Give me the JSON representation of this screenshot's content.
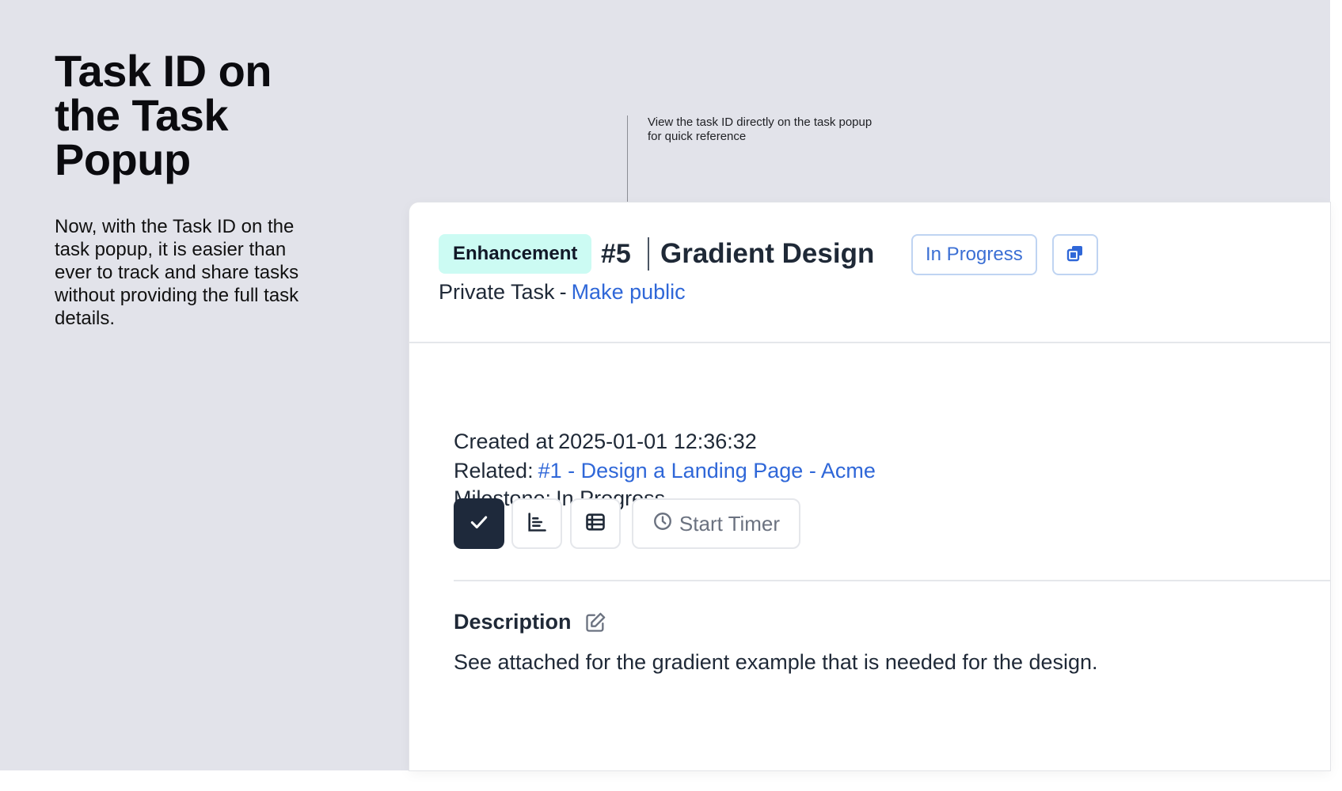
{
  "hero": {
    "title": "Task ID on the Task Popup",
    "description": "Now, with the Task ID on the task popup, it is easier than ever to track and share tasks without providing the full task details."
  },
  "callout": {
    "text": "View the task ID directly on the task popup for quick reference"
  },
  "task": {
    "tag": "Enhancement",
    "id": "#5",
    "title": "Gradient Design",
    "status": "In Progress",
    "copy_icon": "copy-icon",
    "privacy_label": "Private Task",
    "privacy_separator": "-",
    "make_public_link": "Make public",
    "created_label": "Created at",
    "created_value": "2025-01-01 12:36:32",
    "related_label": "Related:",
    "related_link": "#1 - Design a Landing Page - Acme",
    "milestone_label": "Milestone:",
    "milestone_value": "In Progress",
    "actions": {
      "complete_icon": "check-icon",
      "gantt_icon": "bar-chart-icon",
      "list_icon": "table-list-icon",
      "timer_icon": "clock-icon",
      "timer_label": "Start Timer"
    },
    "description_title": "Description",
    "description_edit_icon": "edit-icon",
    "description_body": "See attached for the gradient example that is needed for the design."
  },
  "colors": {
    "background": "#e2e3ea",
    "tag_bg": "#ccfbf3",
    "link": "#2f67d8",
    "status_border": "#bfd4f2",
    "primary_dark": "#1e293b"
  }
}
